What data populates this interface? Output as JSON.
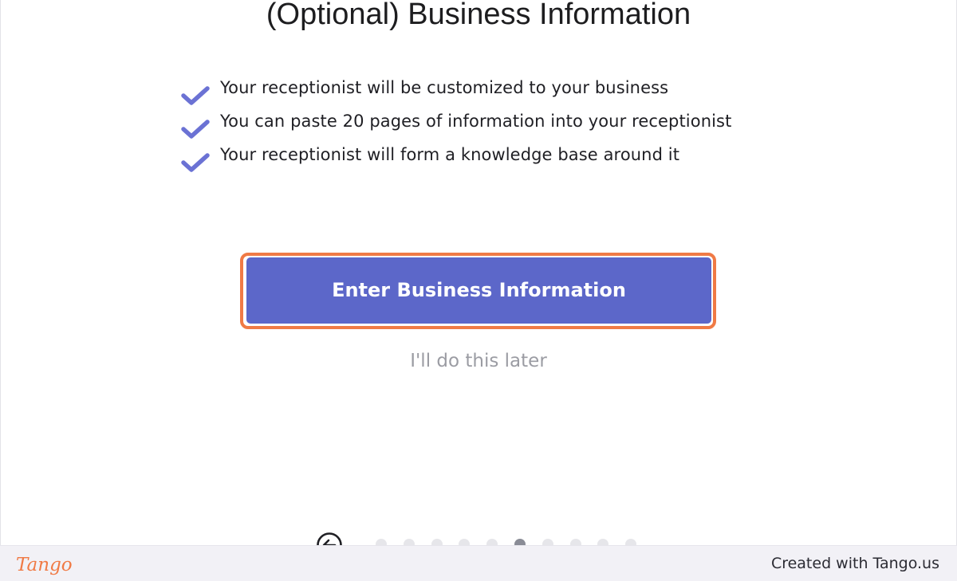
{
  "page": {
    "title": "(Optional) Business Information"
  },
  "benefits": [
    {
      "icon": "check-icon",
      "text": "Your receptionist will be customized to your business"
    },
    {
      "icon": "check-icon",
      "text": "You can paste 20 pages of information into your receptionist"
    },
    {
      "icon": "check-icon",
      "text": "Your receptionist will form a knowledge base around it"
    }
  ],
  "actions": {
    "primary_label": "Enter Business Information",
    "secondary_label": "I'll do this later"
  },
  "pager": {
    "back_icon": "back-arrow-icon",
    "total_steps": 10,
    "current_step": 6
  },
  "footer": {
    "brand": "Tango",
    "credit": "Created with Tango.us"
  },
  "colors": {
    "accent": "#5c67c9",
    "check": "#6b72d4",
    "highlight": "#f07a45",
    "brand": "#f07a45",
    "muted_text": "#9b9ca3"
  }
}
